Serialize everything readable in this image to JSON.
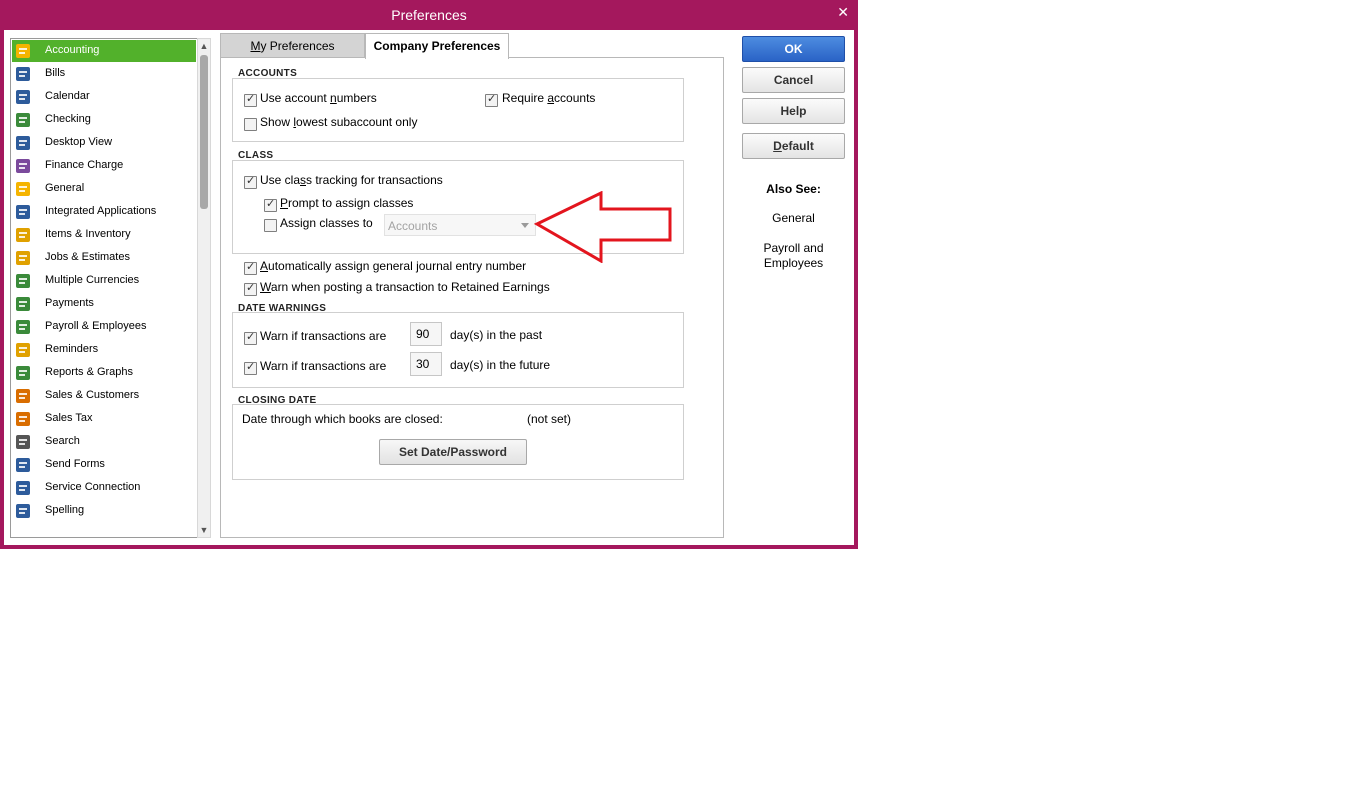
{
  "window": {
    "title": "Preferences",
    "close_glyph": "✕"
  },
  "categories": [
    {
      "label": "Accounting",
      "icon": "accounting-icon",
      "selected": true
    },
    {
      "label": "Bills",
      "icon": "bills-icon"
    },
    {
      "label": "Calendar",
      "icon": "calendar-icon"
    },
    {
      "label": "Checking",
      "icon": "checking-icon"
    },
    {
      "label": "Desktop View",
      "icon": "desktop-view-icon"
    },
    {
      "label": "Finance Charge",
      "icon": "finance-charge-icon"
    },
    {
      "label": "General",
      "icon": "general-icon"
    },
    {
      "label": "Integrated Applications",
      "icon": "integrated-applications-icon"
    },
    {
      "label": "Items & Inventory",
      "icon": "items-inventory-icon"
    },
    {
      "label": "Jobs & Estimates",
      "icon": "jobs-estimates-icon"
    },
    {
      "label": "Multiple Currencies",
      "icon": "multiple-currencies-icon"
    },
    {
      "label": "Payments",
      "icon": "payments-icon"
    },
    {
      "label": "Payroll & Employees",
      "icon": "payroll-employees-icon"
    },
    {
      "label": "Reminders",
      "icon": "reminders-icon"
    },
    {
      "label": "Reports & Graphs",
      "icon": "reports-graphs-icon"
    },
    {
      "label": "Sales & Customers",
      "icon": "sales-customers-icon"
    },
    {
      "label": "Sales Tax",
      "icon": "sales-tax-icon"
    },
    {
      "label": "Search",
      "icon": "search-icon"
    },
    {
      "label": "Send Forms",
      "icon": "send-forms-icon"
    },
    {
      "label": "Service Connection",
      "icon": "service-connection-icon"
    },
    {
      "label": "Spelling",
      "icon": "spelling-icon"
    }
  ],
  "tabs": {
    "my_prefs": {
      "pre": "",
      "mnemonic": "M",
      "post": "y Preferences"
    },
    "company_prefs": "Company Preferences"
  },
  "accounts": {
    "title": "ACCOUNTS",
    "use_account_numbers": {
      "pre": "Use account ",
      "mnemonic": "n",
      "post": "umbers",
      "checked": true
    },
    "require_accounts": {
      "pre": "Require ",
      "mnemonic": "a",
      "post": "ccounts",
      "checked": true
    },
    "show_lowest": {
      "pre": "Show ",
      "mnemonic": "l",
      "post": "owest subaccount only",
      "checked": false
    }
  },
  "class": {
    "title": "CLASS",
    "use_class_tracking": {
      "pre": "Use cla",
      "mnemonic": "s",
      "post": "s tracking for transactions",
      "checked": true
    },
    "prompt_assign": {
      "pre": "",
      "mnemonic": "P",
      "post": "rompt to assign classes",
      "checked": true
    },
    "assign_classes_to": {
      "pre": "Assi",
      "mnemonic": "g",
      "post": "n classes to",
      "checked": false
    },
    "assign_combo_value": "Accounts"
  },
  "auto_journal": {
    "pre": "",
    "mnemonic": "A",
    "post": "utomatically assign general journal entry number",
    "checked": true
  },
  "warn_retained": {
    "pre": "",
    "mnemonic": "W",
    "post": "arn when posting a transaction to Retained Earnings",
    "checked": true
  },
  "date_warnings": {
    "title": "DATE WARNINGS",
    "past": {
      "label": "Warn if transactions are",
      "value": "90",
      "suffix": "day(s) in the past",
      "checked": true
    },
    "future": {
      "label": "Warn if transactions are",
      "value": "30",
      "suffix": "day(s) in the future",
      "checked": true
    }
  },
  "closing_date": {
    "title": "CLOSING DATE",
    "label": "Date through which books are closed:",
    "value": "(not set)",
    "button": "Set Date/Password"
  },
  "buttons": {
    "ok": "OK",
    "cancel": "Cancel",
    "help": "Help",
    "default_pre": "",
    "default_mnemonic": "D",
    "default_post": "efault"
  },
  "also_see": {
    "title": "Also See:",
    "links": [
      "General",
      "Payroll and Employees"
    ]
  },
  "colors": {
    "titlebar": "#a4185d",
    "selected": "#52b12b",
    "annotation_arrow": "#e3151e",
    "ok_button": "#2a63c6"
  }
}
